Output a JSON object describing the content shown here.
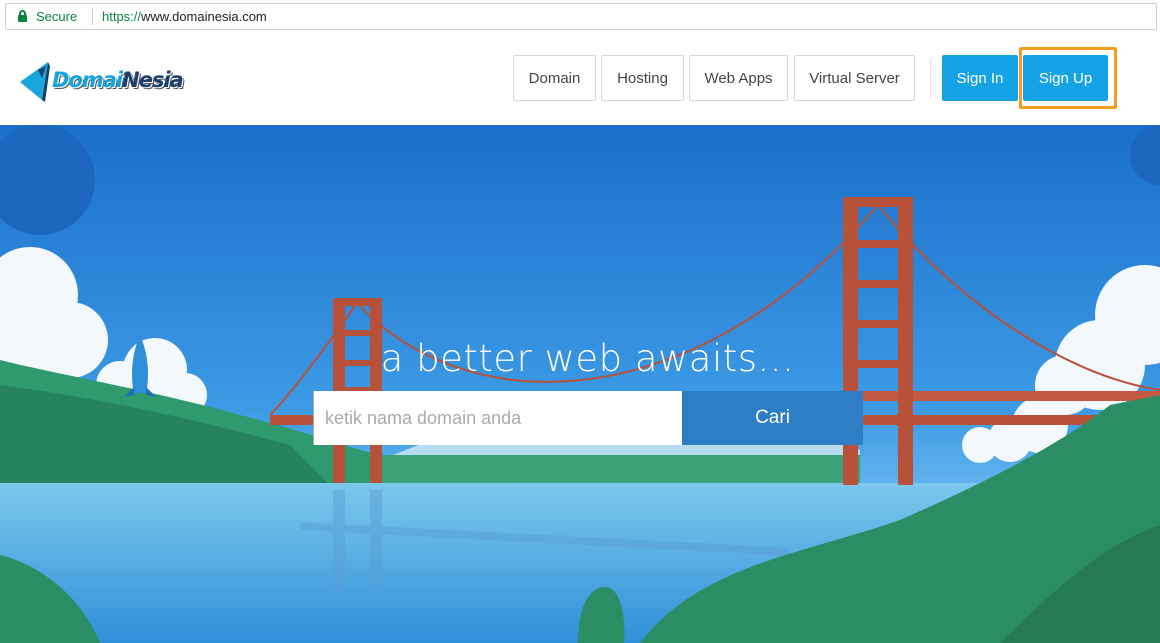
{
  "browser": {
    "secure_label": "Secure",
    "url_protocol": "https://",
    "url_host": "www.domainesia.com"
  },
  "header": {
    "logo_text_a": "Domai",
    "logo_text_b": "Nesia",
    "nav": [
      {
        "label": "Domain"
      },
      {
        "label": "Hosting"
      },
      {
        "label": "Web Apps"
      },
      {
        "label": "Virtual Server"
      }
    ],
    "sign_in_label": "Sign In",
    "sign_up_label": "Sign Up"
  },
  "hero": {
    "tagline": "a better web awaits...",
    "search_placeholder": "ketik nama domain anda",
    "search_button_label": "Cari"
  },
  "colors": {
    "accent": "#16a3e6",
    "secure_green": "#0b8043",
    "highlight_orange": "#f59b1f",
    "search_button": "#2d7ec4"
  }
}
